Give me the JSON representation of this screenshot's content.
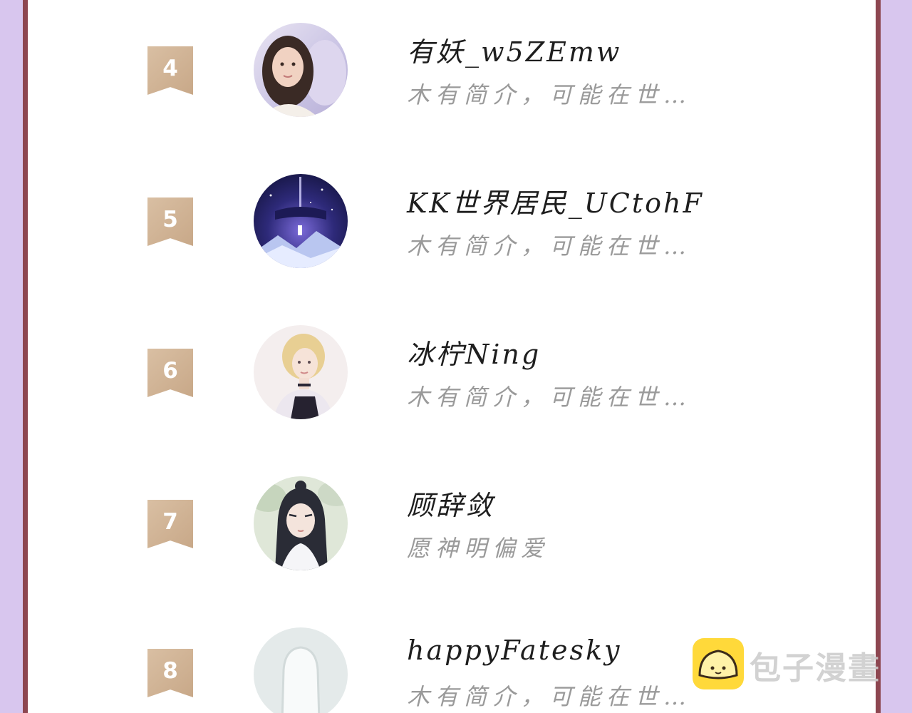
{
  "ranking": {
    "rows": [
      {
        "rank": "4",
        "name": "有妖_w5ZEmw",
        "bio": "木有简介，可能在世…",
        "avatar": "photo-avatar"
      },
      {
        "rank": "5",
        "name": "KK世界居民_UCtohF",
        "bio": "木有简介，可能在世…",
        "avatar": "night-sky-avatar"
      },
      {
        "rank": "6",
        "name": "冰柠Ning",
        "bio": "木有简介，可能在世…",
        "avatar": "illustrated-girl-avatar"
      },
      {
        "rank": "7",
        "name": "顾辞敛",
        "bio": "愿神明偏爱",
        "avatar": "illustrated-boy-avatar"
      },
      {
        "rank": "8",
        "name": "happyFatesky",
        "bio": "木有简介，可能在世…",
        "avatar": "default-avatar"
      }
    ]
  },
  "watermark": {
    "text": "包子漫畫",
    "icon": "baozi-logo-icon"
  },
  "colors": {
    "background": "#d8c6ee",
    "frame": "#8d4650",
    "badge": "#d3b699",
    "name": "#1e1e1e",
    "bio": "#9a9a9a",
    "watermark_icon": "#ffd93a"
  }
}
